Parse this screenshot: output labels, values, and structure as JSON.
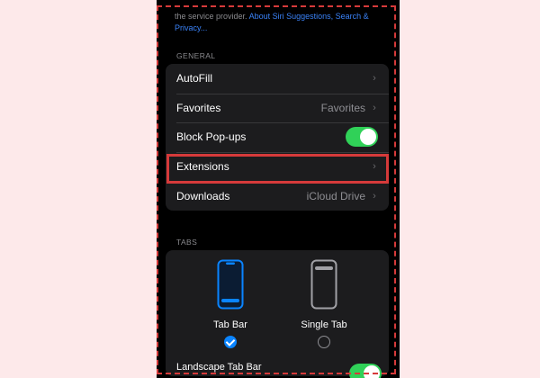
{
  "intro": {
    "text": "the service provider.",
    "link": "About Siri Suggestions, Search & Privacy..."
  },
  "general": {
    "header": "GENERAL",
    "rows": [
      {
        "label": "AutoFill",
        "value": ""
      },
      {
        "label": "Favorites",
        "value": "Favorites"
      },
      {
        "label": "Block Pop-ups",
        "toggle_on": true
      },
      {
        "label": "Extensions",
        "value": ""
      },
      {
        "label": "Downloads",
        "value": "iCloud Drive"
      }
    ]
  },
  "tabs": {
    "header": "TABS",
    "options": [
      {
        "label": "Tab Bar",
        "selected": true
      },
      {
        "label": "Single Tab",
        "selected": false
      }
    ]
  },
  "bottom": {
    "label": "Landscape Tab Bar",
    "toggle_on": true
  },
  "colors": {
    "accent_blue": "#0a84ff",
    "toggle_green": "#30d158",
    "highlight_red": "#d63a3a",
    "background": "#fde9ea"
  },
  "icons": {
    "chevron": "chevron-right-icon",
    "tab_bar_phone": "phone-tab-bar-icon",
    "single_tab_phone": "phone-single-tab-icon"
  }
}
